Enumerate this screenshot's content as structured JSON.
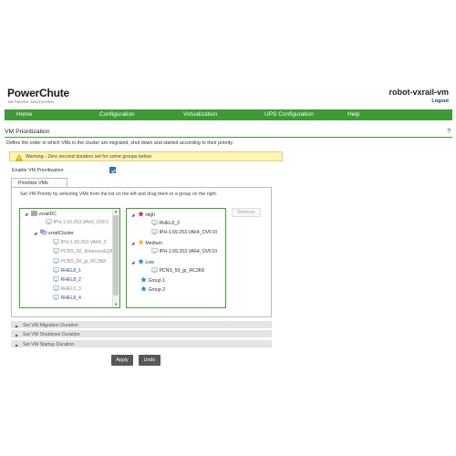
{
  "brand": {
    "name": "PowerChute",
    "tagline": "NETWORK SHUTDOWN"
  },
  "header": {
    "hostname": "robot-vxrail-vm",
    "logout_label": "Logout"
  },
  "nav": [
    "Home",
    "Configuration",
    "Virtualization",
    "UPS Configuration",
    "Help"
  ],
  "page": {
    "title": "VM Prioritization",
    "help": "?",
    "description": "Define the order in which VMs in the cluster are migrated, shut down and started according to their priority.",
    "warning": "Warning - Zero second duration set for some groups below.",
    "enable_label": "Enable VM Prioritization",
    "enable_checked": true
  },
  "tab": {
    "label": "Prioritize VMs"
  },
  "instructions": "Set VM Priority by selecting VMs from the list on the left and drag them to a group on the right.",
  "left_tree": {
    "datacenter": "vxrailDC",
    "dc_vm": "IPH-1.69.253.VA64_OVF1",
    "cluster": "vxrailCluster",
    "vms": [
      {
        "label": "IPH-1.69.253.VA64_C",
        "muted": true
      },
      {
        "label": "PCNS_50_Ikhansys&QA",
        "muted": true
      },
      {
        "label": "PCNS_50_jp_RC3K8",
        "muted": true
      },
      {
        "label": "RHEL8_1",
        "muted": false
      },
      {
        "label": "RHEL8_2",
        "muted": false
      },
      {
        "label": "RHEL8_3",
        "muted": true
      },
      {
        "label": "RHEL8_4",
        "muted": false
      }
    ]
  },
  "right_tree": {
    "groups": [
      {
        "label": "High",
        "vms": [
          "RHEL8_3"
        ]
      },
      {
        "label": "Medium",
        "vms": [
          "IPH-1.69.253.VA64_OVF10"
        ]
      },
      {
        "label": "Low",
        "vms": [
          "PCNS_50_jp_RC3K8"
        ]
      }
    ],
    "high_vm_top": "IPH-1.69.253.VA64_OVF10",
    "extra_groups": [
      "Group 1",
      "Group 2"
    ]
  },
  "remove_label": "Remove",
  "sections": [
    "Set VM Migration Duration",
    "Set VM Shutdown Duration",
    "Set VM Startup Duration"
  ],
  "buttons": {
    "apply": "Apply",
    "undo": "Undo"
  },
  "colors": {
    "nav_green": "#3d9a35",
    "warning_bg": "#fff6b0",
    "high": "#c0335a",
    "medium": "#e8c02a",
    "low": "#2c8ed6"
  }
}
